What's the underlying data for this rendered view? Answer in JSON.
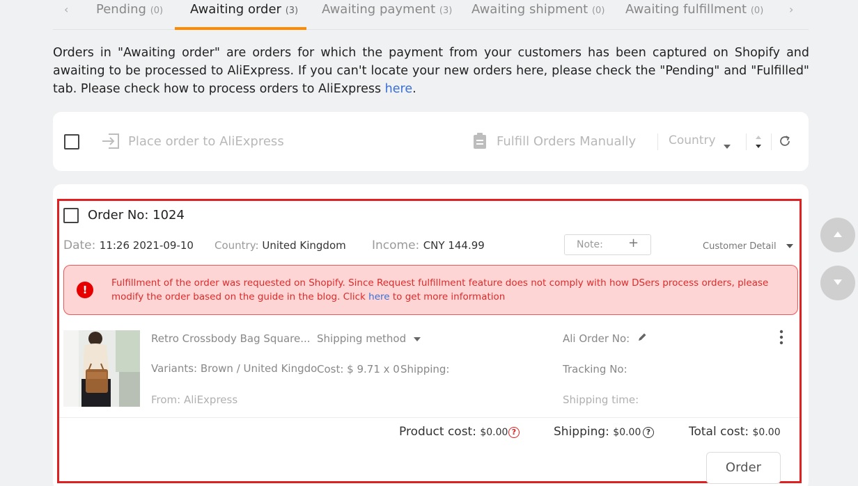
{
  "tabs": [
    {
      "label": "Pending",
      "count": "(0)"
    },
    {
      "label": "Awaiting order",
      "count": "(3)"
    },
    {
      "label": "Awaiting payment",
      "count": "(3)"
    },
    {
      "label": "Awaiting shipment",
      "count": "(0)"
    },
    {
      "label": "Awaiting fulfillment",
      "count": "(0)"
    }
  ],
  "active_tab": "Awaiting order",
  "intro": {
    "text": "Orders in \"Awaiting order\" are orders for which the payment from your customers has been captured on Shopify and awaiting to be processed to AliExpress. If you can't locate your new orders here, please check the \"Pending\" and \"Fulfilled\" tab. Please check how to process orders to AliExpress ",
    "link": "here",
    "end": "."
  },
  "toolbar": {
    "place_order": "Place order to AliExpress",
    "fulfill_manually": "Fulfill Orders Manually",
    "country": "Country"
  },
  "order": {
    "title": "Order No: 1024",
    "date_label": "Date:",
    "date_value": "11:26 2021-09-10",
    "country_label": "Country:",
    "country_value": "United Kingdom",
    "income_label": "Income:",
    "income_value": "CNY 144.99",
    "note_label": "Note:",
    "note_plus": "+",
    "customer_detail": "Customer Detail",
    "alert": {
      "text": "Fulfillment of the order was requested on Shopify. Since Request fulfillment feature does not comply with how DSers process orders, please modify the order based on the guide in the blog. Click ",
      "link": "here",
      "end": " to get more information",
      "icon": "!"
    },
    "item": {
      "name": "Retro Crossbody Bag Square...",
      "shipping_method": "Shipping method",
      "ali_order_no": "Ali Order No:",
      "variants": "Variants: Brown / United Kingdo",
      "cost": "Cost: $ 9.71 x 0",
      "shipping": "Shipping:",
      "tracking_no": "Tracking No:",
      "from": "From: AliExpress",
      "shipping_time": "Shipping time:"
    },
    "summary": {
      "product_cost_label": "Product cost:",
      "product_cost_value": "$0.00",
      "shipping_label": "Shipping:",
      "shipping_value": "$0.00",
      "total_label": "Total cost:",
      "total_value": "$0.00"
    },
    "order_button": "Order"
  },
  "colors": {
    "accent": "#ff8a00",
    "highlight_border": "#e02020",
    "alert_bg": "#fdd5d5",
    "alert_text": "#e02a2a",
    "link": "#3a6fd8"
  }
}
